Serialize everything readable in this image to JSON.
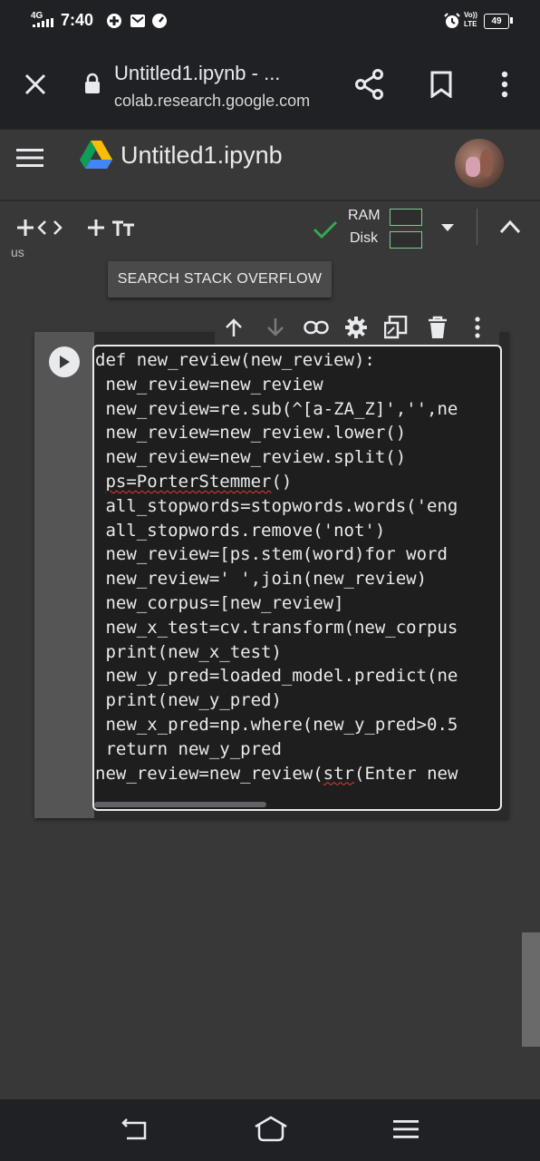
{
  "status_bar": {
    "network": "4G",
    "time": "7:40",
    "volte": "Vo))",
    "lte": "LTE",
    "battery": "49"
  },
  "browser": {
    "page_title": "Untitled1.ipynb - ...",
    "domain": "colab.research.google.com"
  },
  "colab": {
    "notebook_title": "Untitled1.ipynb",
    "ram_label": "RAM",
    "disk_label": "Disk",
    "partial_text": "us"
  },
  "tooltip": {
    "label": "SEARCH STACK OVERFLOW"
  },
  "code_lines": [
    "def new_review(new_review):",
    " new_review=new_review",
    " new_review=re.sub(^[a-ZA_Z]','',ne",
    " new_review=new_review.lower()",
    " new_review=new_review.split()",
    " ps=PorterStemmer()",
    " all_stopwords=stopwords.words('eng",
    " all_stopwords.remove('not')",
    " new_review=[ps.stem(word)for word ",
    " new_review=' ',join(new_review)",
    " new_corpus=[new_review]",
    " new_x_test=cv.transform(new_corpus",
    " print(new_x_test)",
    " new_y_pred=loaded_model.predict(ne",
    " print(new_y_pred)",
    " new_x_pred=np.where(new_y_pred>0.5",
    " return new_y_pred",
    "new_review=new_review(str(Enter new"
  ],
  "icons": {
    "close": "close-icon",
    "lock": "lock-icon",
    "share": "share-icon",
    "bookmark": "bookmark-icon",
    "menu": "more-vert-icon"
  },
  "colors": {
    "background": "#383838",
    "bars": "#202124",
    "accent_check": "#34a853"
  }
}
